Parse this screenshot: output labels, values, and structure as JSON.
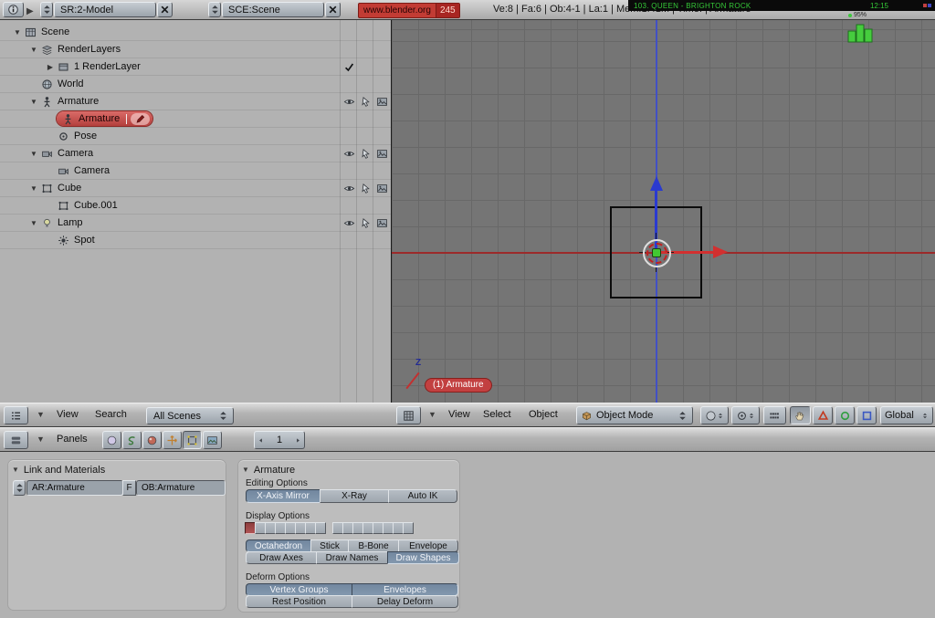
{
  "header": {
    "screen_selector": "SR:2-Model",
    "scene_selector": "SCE:Scene",
    "version_site": "www.blender.org",
    "version_number": "245",
    "stats": "Ve:8 | Fa:6 | Ob:4-1 | La:1 | Mem:1.41M | Time: | Armature",
    "overlay": {
      "track": "103. QUEEN - BRIGHTON ROCK",
      "time": "12:15",
      "meter": "95%"
    }
  },
  "outliner": {
    "header": {
      "menus": [
        "View",
        "Search"
      ],
      "scene_filter": "All Scenes"
    },
    "items": [
      {
        "label": "Scene",
        "depth": 0,
        "icon": "scene-icon",
        "expand": "open"
      },
      {
        "label": "RenderLayers",
        "depth": 1,
        "icon": "renderlayers-icon",
        "expand": "open"
      },
      {
        "label": "1 RenderLayer",
        "depth": 2,
        "icon": "renderlayer-icon",
        "expand": "closed",
        "check": true
      },
      {
        "label": "World",
        "depth": 1,
        "icon": "world-icon"
      },
      {
        "label": "Armature",
        "depth": 1,
        "icon": "armature-icon",
        "expand": "open",
        "restrict": true
      },
      {
        "label": "Armature",
        "depth": 2,
        "icon": "armature-icon",
        "selected": true
      },
      {
        "label": "Pose",
        "depth": 2,
        "icon": "pose-icon"
      },
      {
        "label": "Camera",
        "depth": 1,
        "icon": "camera-icon",
        "expand": "open",
        "restrict": true
      },
      {
        "label": "Camera",
        "depth": 2,
        "icon": "camera-icon"
      },
      {
        "label": "Cube",
        "depth": 1,
        "icon": "mesh-icon",
        "expand": "open",
        "restrict": true
      },
      {
        "label": "Cube.001",
        "depth": 2,
        "icon": "mesh-icon"
      },
      {
        "label": "Lamp",
        "depth": 1,
        "icon": "lamp-icon",
        "expand": "open",
        "restrict": true
      },
      {
        "label": "Spot",
        "depth": 2,
        "icon": "spot-icon"
      }
    ]
  },
  "viewport": {
    "header": {
      "menus": [
        "View",
        "Select",
        "Object"
      ],
      "mode": "Object Mode",
      "orientation": "Global"
    },
    "active_object_badge": "(1) Armature",
    "axis_label": "Z"
  },
  "buttons_window": {
    "header": {
      "panels_label": "Panels",
      "frame": "1"
    },
    "link_panel": {
      "title": "Link and Materials",
      "armature_field": "AR:Armature",
      "fake_user_label": "F",
      "object_field": "OB:Armature"
    },
    "armature_panel": {
      "title": "Armature",
      "editing_options_label": "Editing Options",
      "editing_buttons": [
        {
          "label": "X-Axis Mirror",
          "active": true
        },
        {
          "label": "X-Ray",
          "active": false
        },
        {
          "label": "Auto IK",
          "active": false
        }
      ],
      "display_options_label": "Display Options",
      "layers": {
        "count": 16,
        "active": [
          0
        ]
      },
      "bone_type_buttons": [
        {
          "label": "Octahedron",
          "active": true
        },
        {
          "label": "Stick",
          "active": false
        },
        {
          "label": "B-Bone",
          "active": false
        },
        {
          "label": "Envelope",
          "active": false
        }
      ],
      "draw_buttons": [
        {
          "label": "Draw Axes",
          "active": false
        },
        {
          "label": "Draw Names",
          "active": false
        },
        {
          "label": "Draw Shapes",
          "active": true
        }
      ],
      "deform_options_label": "Deform Options",
      "deform_buttons_row1": [
        {
          "label": "Vertex Groups",
          "active": true
        },
        {
          "label": "Envelopes",
          "active": true
        }
      ],
      "deform_buttons_row2": [
        {
          "label": "Rest Position",
          "active": false
        },
        {
          "label": "Delay Deform",
          "active": false
        }
      ]
    }
  }
}
